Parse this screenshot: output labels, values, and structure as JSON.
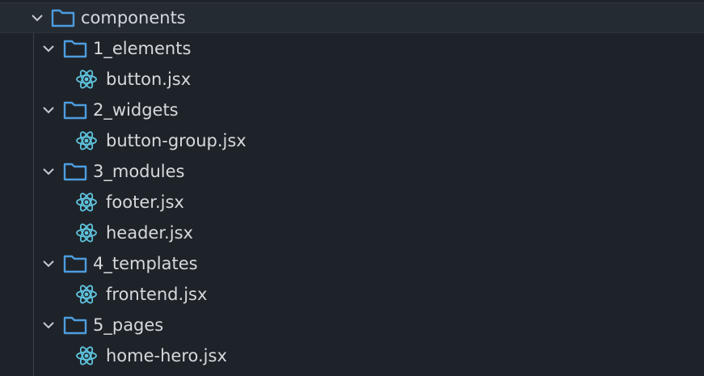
{
  "explorer": {
    "root": {
      "label": "components",
      "expanded": true
    },
    "folders": [
      {
        "label": "1_elements",
        "expanded": true,
        "files": [
          "button.jsx"
        ]
      },
      {
        "label": "2_widgets",
        "expanded": true,
        "files": [
          "button-group.jsx"
        ]
      },
      {
        "label": "3_modules",
        "expanded": true,
        "files": [
          "footer.jsx",
          "header.jsx"
        ]
      },
      {
        "label": "4_templates",
        "expanded": true,
        "files": [
          "frontend.jsx"
        ]
      },
      {
        "label": "5_pages",
        "expanded": true,
        "files": [
          "home-hero.jsx"
        ]
      }
    ],
    "icons": {
      "folder": "folder-icon",
      "file": "react-icon",
      "expand": "chevron-down-icon"
    },
    "colors": {
      "background": "#1e2329",
      "folder": "#4d9de0",
      "react": "#5fc4de",
      "text": "#d6d9de",
      "chevron": "#c7cbd1"
    }
  }
}
